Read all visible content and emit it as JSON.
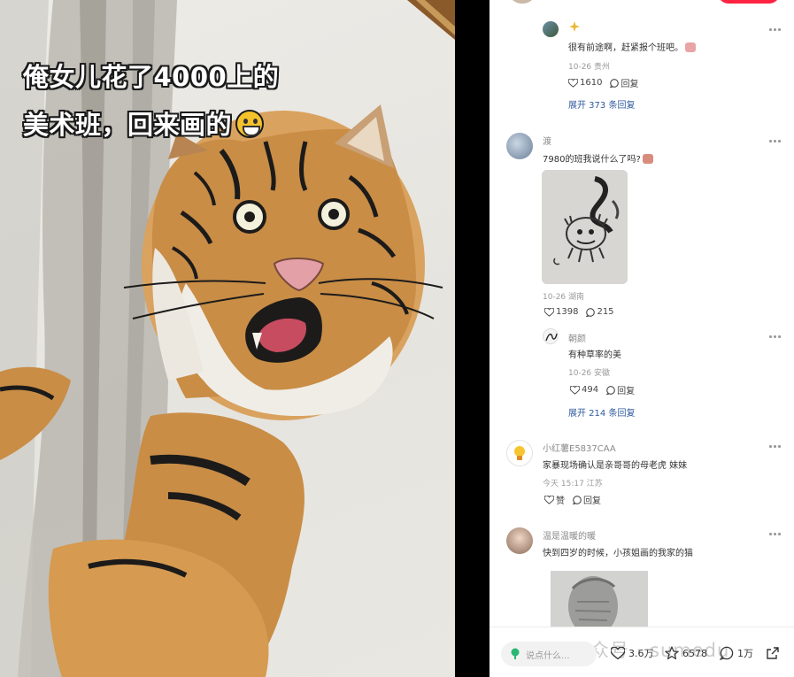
{
  "media": {
    "caption_line1": "俺女儿花了4000上的",
    "caption_line2": "美术班，回来画的"
  },
  "comments": [
    {
      "id": "c1",
      "username": "",
      "text": "很有前途啊，赶紧报个班吧。",
      "meta": "10-26 贵州",
      "likes": "1610",
      "reply_label": "回复",
      "expand": "展开 373 条回复"
    },
    {
      "id": "c2",
      "username": "渡",
      "text": "7980的班我说什么了吗?",
      "meta": "10-26 湖南",
      "likes": "1398",
      "replies": "215"
    },
    {
      "id": "c3",
      "username": "朝颜",
      "text": "有种草率的美",
      "meta": "10-26 安徽",
      "likes": "494",
      "reply_label": "回复",
      "expand": "展开 214 条回复"
    },
    {
      "id": "c4",
      "username": "小红薯E5837CAA",
      "text": "家暴现场确认是亲哥哥的母老虎 妹妹",
      "meta": "今天 15:17 江苏",
      "like_label": "赞",
      "reply_label": "回复"
    },
    {
      "id": "c5",
      "username": "温是温暖的暖",
      "text": "快到四岁的时候，小孩姐画的我家的猫"
    }
  ],
  "bottom_bar": {
    "input_placeholder": "说点什么...",
    "likes": "3.6万",
    "stars": "6578",
    "comments": "1万",
    "watermark": "公众号 · sumedu"
  },
  "colors": {
    "accent_red": "#ff2442",
    "link_blue": "#2f5a9e",
    "meta_gray": "#9a9a9a"
  }
}
